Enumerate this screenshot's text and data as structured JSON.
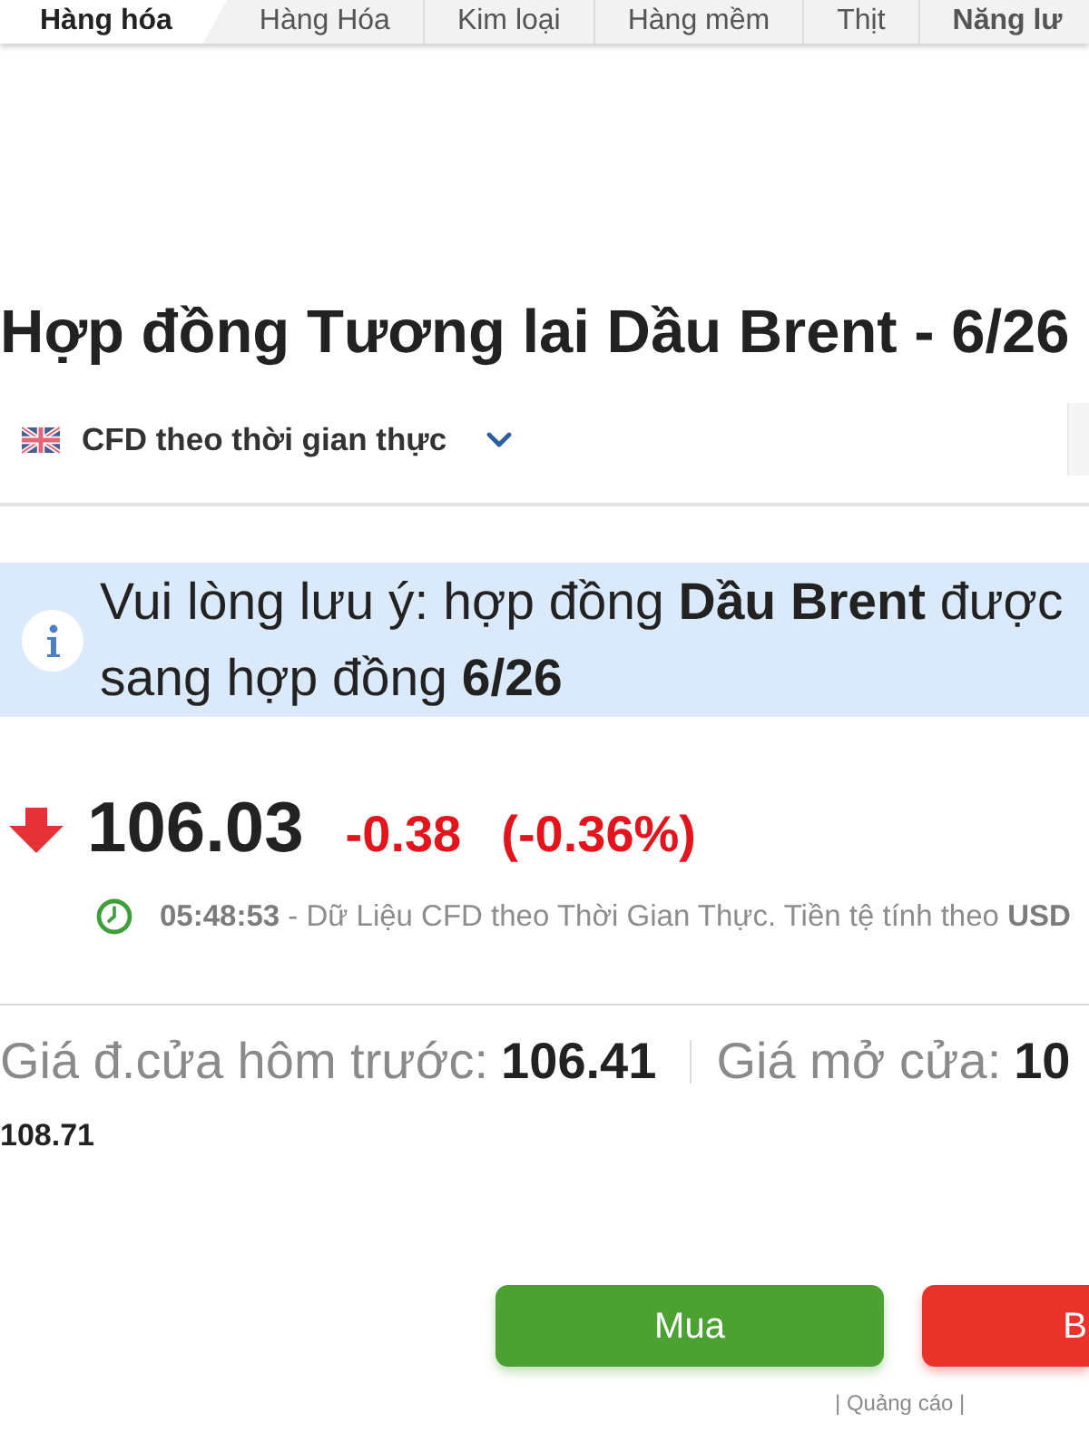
{
  "tabs": [
    {
      "label": "Hàng hóa",
      "selected": true,
      "emphasized": true
    },
    {
      "label": "Hàng Hóa",
      "selected": false,
      "emphasized": false
    },
    {
      "label": "Kim loại",
      "selected": false,
      "emphasized": false
    },
    {
      "label": "Hàng mềm",
      "selected": false,
      "emphasized": false
    },
    {
      "label": "Thịt",
      "selected": false,
      "emphasized": false
    },
    {
      "label": "Năng lư",
      "selected": false,
      "emphasized": true
    }
  ],
  "title": "Hợp đồng Tương lai Dầu Brent - 6/26",
  "source_selector": {
    "label": "CFD theo thời gian thực"
  },
  "notice": {
    "lines": [
      "Vui lòng lưu ý: hợp đồng **Dầu Brent** được",
      "sang hợp đồng **6/26**"
    ]
  },
  "quote": {
    "falling": true,
    "price": "106.03",
    "change": "-0.38",
    "change_percent": "(-0.36%)",
    "timestamp_line": "**05:48:53** - Dữ Liệu CFD theo Thời Gian Thực. Tiền tệ tính theo **USD**"
  },
  "stats": [
    {
      "label": "Giá đ.cửa hôm trước:",
      "value": "106.41"
    },
    {
      "label": "Giá mở cửa:",
      "value": "10"
    }
  ],
  "stats_line_2": "108.71",
  "trade_buttons": [
    {
      "kind": "buy",
      "label": "Mua"
    },
    {
      "kind": "sell",
      "label": "B"
    }
  ],
  "ad_label": "| Quảng cáo |"
}
